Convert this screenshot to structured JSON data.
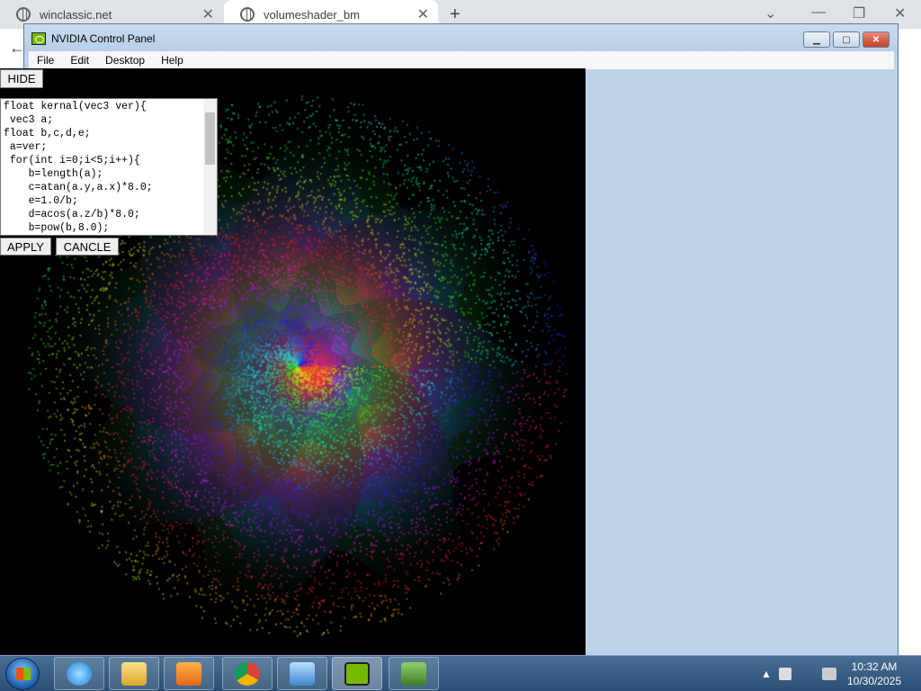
{
  "browser": {
    "tabs": [
      {
        "title": "winclassic.net",
        "close": "✕"
      },
      {
        "title": "volumeshader_bm",
        "close": "✕"
      }
    ],
    "new_tab": "+",
    "back": "←",
    "window_controls": {
      "dropdown": "⌄",
      "minimize": "—",
      "restore": "❐",
      "close": "✕"
    }
  },
  "nvidia_window": {
    "title": "NVIDIA Control Panel",
    "menu": [
      "File",
      "Edit",
      "Desktop",
      "Help"
    ],
    "buttons": {
      "minimize": "▁",
      "maximize": "▢",
      "close": "✕"
    }
  },
  "shader": {
    "hide_label": "HIDE",
    "apply_label": "APPLY",
    "cancel_label": "CANCLE",
    "code": "float kernal(vec3 ver){\n vec3 a;\nfloat b,c,d,e;\n a=ver;\n for(int i=0;i<5;i++){\n    b=length(a);\n    c=atan(a.y,a.x)*8.0;\n    e=1.0/b;\n    d=acos(a.z/b)*8.0;\n    b=pow(b,8.0);"
  },
  "taskbar": {
    "items": [
      "internet-explorer-icon",
      "file-explorer-icon",
      "media-player-icon",
      "chrome-icon",
      "control-panel-icon",
      "nvidia-icon",
      "network-icon"
    ],
    "clock_time": "10:32 AM",
    "clock_date": "10/30/2025",
    "tray_arrow": "▲"
  }
}
